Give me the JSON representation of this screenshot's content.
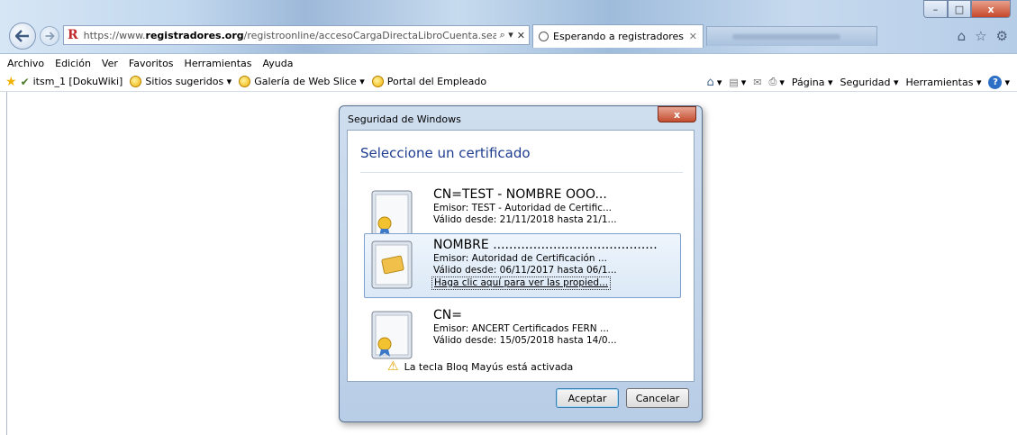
{
  "browser": {
    "url_prefix": "https://www.",
    "url_domain": "registradores.org",
    "url_rest": "/registroonline/accesoCargaDirectaLibroCuenta.seam?tipoC",
    "search_glyph": "⌕ ▾",
    "stop_glyph": "✕",
    "active_tab": "Esperando a registradores.o...",
    "active_tab_close": "✕"
  },
  "window_controls": {
    "minimize": "–",
    "maximize": "□",
    "close": "x"
  },
  "right_icons": [
    "home-icon",
    "favorites-icon",
    "settings-icon"
  ],
  "menu": [
    "Archivo",
    "Edición",
    "Ver",
    "Favoritos",
    "Herramientas",
    "Ayuda"
  ],
  "favorites": [
    {
      "label": "itsm_1 [DokuWiki]",
      "icon": "wiki-icon"
    },
    {
      "label": "Sitios sugeridos ▾",
      "icon": "ie-icon"
    },
    {
      "label": "Galería de Web Slice ▾",
      "icon": "ie-icon"
    },
    {
      "label": "Portal del Empleado",
      "icon": "ie-icon"
    }
  ],
  "command_bar": {
    "home": "▾",
    "feeds": "▾",
    "mail": "▾",
    "print": "▾",
    "page": "Página ▾",
    "security": "Seguridad ▾",
    "tools": "Herramientas ▾",
    "help": "▾"
  },
  "dialog": {
    "title": "Seguridad de Windows",
    "close": "x",
    "heading": "Seleccione un certificado",
    "certificates": [
      {
        "name": "CN=TEST - NOMBRE OOO...",
        "issuer": "Emisor: TEST - Autoridad de Certific...",
        "valid": "Válido desde: 21/11/2018 hasta 21/1...",
        "type": "seal"
      },
      {
        "name": "NOMBRE .........................................",
        "issuer": "Emisor: Autoridad de Certificación ...",
        "valid": "Válido desde: 06/11/2017 hasta 06/1...",
        "link": "Haga clic aquí para ver las propied...",
        "type": "smartcard",
        "selected": true
      },
      {
        "name": "CN=",
        "issuer": "Emisor: ANCERT Certificados FERN ...",
        "valid": "Válido desde: 15/05/2018 hasta 14/0...",
        "type": "seal"
      }
    ],
    "warning": "La tecla Bloq Mayús está activada",
    "ok": "Aceptar",
    "cancel": "Cancelar"
  }
}
